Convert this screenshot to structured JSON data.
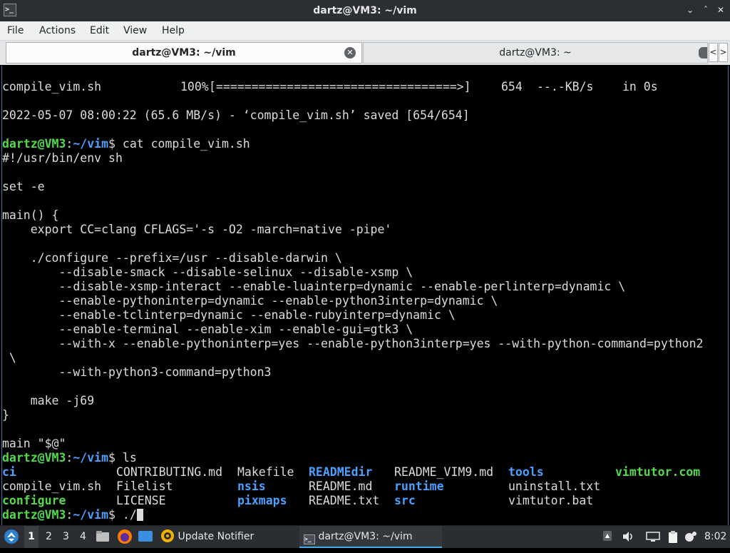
{
  "window": {
    "title": "dartz@VM3: ~/vim",
    "app_icon": "terminal-icon",
    "minimize_icon": "minimize-icon",
    "maximize_icon": "maximize-icon",
    "close_icon": "close-icon"
  },
  "menubar": {
    "items": [
      "File",
      "Actions",
      "Edit",
      "View",
      "Help"
    ]
  },
  "tabs": [
    {
      "label": "dartz@VM3: ~/vim",
      "active": true
    },
    {
      "label": "dartz@VM3: ~",
      "active": false
    }
  ],
  "terminal": {
    "progress": {
      "file": "compile_vim.sh",
      "percent": "100%",
      "bar": "[==================================>]",
      "size": "654",
      "rate": "--.-KB/s",
      "eta": "in 0s"
    },
    "saved_line": "2022-05-07 08:00:22 (65.6 MB/s) - ‘compile_vim.sh’ saved [654/654]",
    "prompt": {
      "user_host": "dartz@VM3",
      "colon": ":",
      "path": "~/vim",
      "symbol": "$"
    },
    "cat_command": " cat compile_vim.sh",
    "script_lines": [
      "#!/usr/bin/env sh",
      "",
      "set -e",
      "",
      "main() {",
      "    export CC=clang CFLAGS='-s -O2 -march=native -pipe'",
      "",
      "    ./configure --prefix=/usr --disable-darwin \\",
      "        --disable-smack --disable-selinux --disable-xsmp \\",
      "        --disable-xsmp-interact --enable-luainterp=dynamic --enable-perlinterp=dynamic \\",
      "        --enable-pythoninterp=dynamic --enable-python3interp=dynamic \\",
      "        --enable-tclinterp=dynamic --enable-rubyinterp=dynamic \\",
      "        --enable-terminal --enable-xim --enable-gui=gtk3 \\",
      "        --with-x --enable-pythoninterp=yes --enable-python3interp=yes --with-python-command=python2",
      " \\",
      "        --with-python3-command=python3",
      "",
      "    make -j69",
      "}",
      "",
      "main \"$@\""
    ],
    "ls_command": " ls",
    "ls_rows": [
      [
        {
          "text": "ci",
          "style": "dir"
        },
        {
          "text": "CONTRIBUTING.md",
          "style": "file"
        },
        {
          "text": "Makefile",
          "style": "file"
        },
        {
          "text": "READMEdir",
          "style": "dir"
        },
        {
          "text": "README_VIM9.md",
          "style": "file"
        },
        {
          "text": "tools",
          "style": "dir"
        },
        {
          "text": "vimtutor.com",
          "style": "exec"
        }
      ],
      [
        {
          "text": "compile_vim.sh",
          "style": "file"
        },
        {
          "text": "Filelist",
          "style": "file"
        },
        {
          "text": "nsis",
          "style": "dir"
        },
        {
          "text": "README.md",
          "style": "file"
        },
        {
          "text": "runtime",
          "style": "dir"
        },
        {
          "text": "uninstall.txt",
          "style": "file"
        }
      ],
      [
        {
          "text": "configure",
          "style": "exec"
        },
        {
          "text": "LICENSE",
          "style": "file"
        },
        {
          "text": "pixmaps",
          "style": "dir"
        },
        {
          "text": "README.txt",
          "style": "file"
        },
        {
          "text": "src",
          "style": "dir"
        },
        {
          "text": "vimtutor.bat",
          "style": "file"
        }
      ]
    ],
    "current_input": " ./",
    "colors": {
      "prompt_green": "#55d94c",
      "dir_blue": "#4aa0ff",
      "text": "#dcdcdc",
      "background": "#000000"
    }
  },
  "taskbar": {
    "start_icon": "start-menu-icon",
    "workspaces": [
      "1",
      "2",
      "3",
      "4"
    ],
    "active_workspace": "1",
    "launchers": [
      "file-manager-icon",
      "firefox-icon",
      "desktop-icon"
    ],
    "tasks": [
      {
        "label": "Update Notifier",
        "icon": "update-notifier-icon"
      },
      {
        "label": "dartz@VM3: ~/vim",
        "icon": "terminal-icon"
      }
    ],
    "tray_icons": [
      "hidden-icons-arrow-icon",
      "volume-icon",
      "network-icon",
      "clipboard-icon",
      "notifications-icon"
    ],
    "clock": "8:02"
  }
}
